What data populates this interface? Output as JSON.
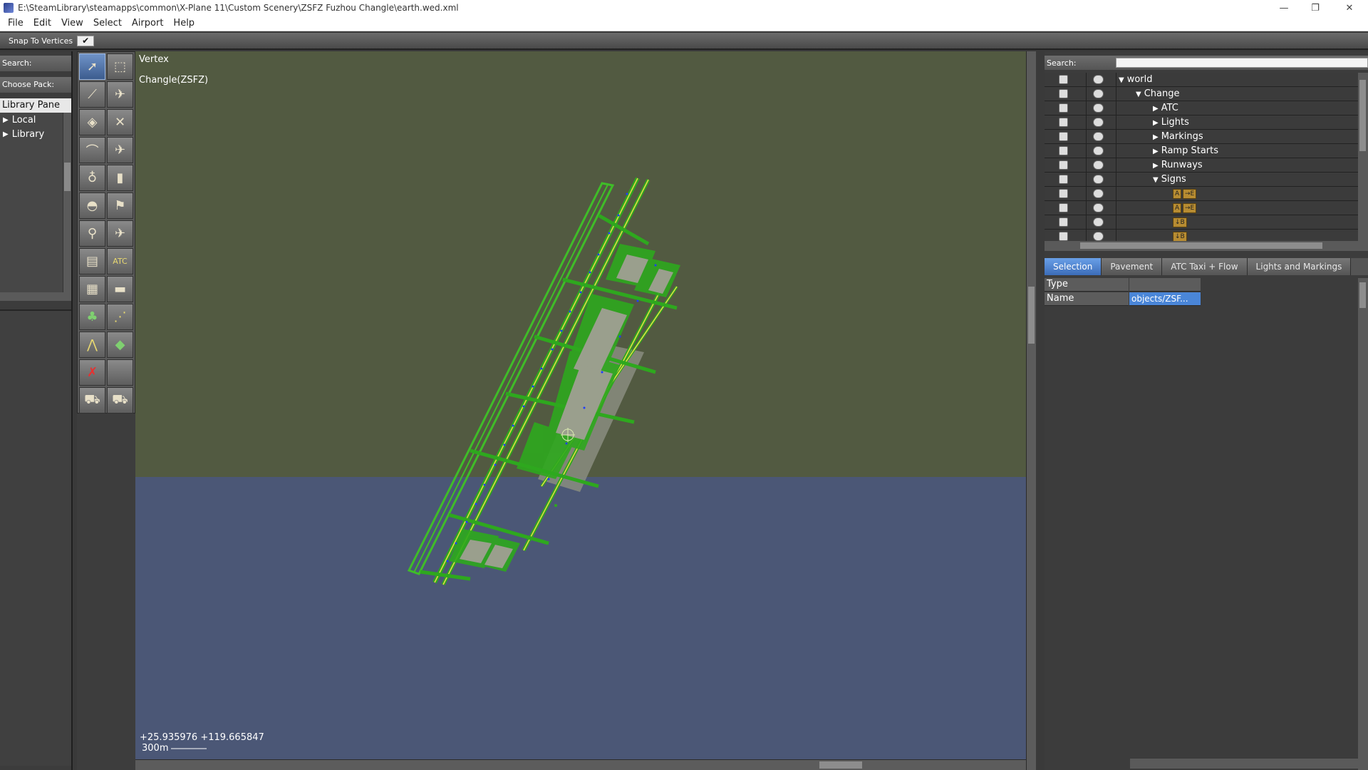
{
  "window": {
    "title": "E:\\SteamLibrary\\steamapps\\common\\X-Plane 11\\Custom Scenery\\ZSFZ Fuzhou Changle\\earth.wed.xml",
    "minimize": "—",
    "restore": "❐",
    "close": "✕"
  },
  "menu": [
    "File",
    "Edit",
    "View",
    "Select",
    "Airport",
    "Help"
  ],
  "toolbar": {
    "snap_label": "Snap To Vertices",
    "snap_check": "✔"
  },
  "library": {
    "search_label": "Search:",
    "pack_label": "Choose Pack:",
    "header": "Library Pane",
    "items": [
      {
        "label": "Local",
        "icon": "triangle-right-icon"
      },
      {
        "label": "Library",
        "icon": "triangle-right-icon"
      }
    ]
  },
  "tools": [
    "vertex-tool-icon",
    "marquee-tool-icon",
    "runway-tool-icon",
    "helipad-tool-icon",
    "sealane-tool-icon",
    "taxiway-tool-icon",
    "boundary-tool-icon",
    "ramp-start-tool-icon",
    "light-fixture-tool-icon",
    "sign-tool-icon",
    "tower-viewpoint-tool-icon",
    "windsock-tool-icon",
    "beacon-tool-icon",
    "airplane-tool-icon",
    "facade-tool-icon",
    "atc-tool-icon",
    "forest-tool-icon",
    "object-tool-icon",
    "tree-tool-icon",
    "string-tool-icon",
    "line-tool-icon",
    "polygon-tool-icon",
    "exclusion-tool-icon",
    "blank-tool-icon",
    "truck-parking-tool-icon",
    "truck-destination-tool-icon"
  ],
  "tool_labels": {
    "atc": "ATC"
  },
  "map": {
    "mode": "Vertex",
    "airport": "Changle(ZSFZ)",
    "coords": "+25.935976 +119.665847",
    "scale": "300m"
  },
  "hierarchy": {
    "search_label": "Search:",
    "rows": [
      {
        "label": "world",
        "depth": 0,
        "expanded": true
      },
      {
        "label": "Change",
        "depth": 1,
        "expanded": true
      },
      {
        "label": "ATC",
        "depth": 2,
        "expanded": false
      },
      {
        "label": "Lights",
        "depth": 2,
        "expanded": false
      },
      {
        "label": "Markings",
        "depth": 2,
        "expanded": false
      },
      {
        "label": "Ramp Starts",
        "depth": 2,
        "expanded": false
      },
      {
        "label": "Runways",
        "depth": 2,
        "expanded": false
      },
      {
        "label": "Signs",
        "depth": 2,
        "expanded": true
      }
    ],
    "signs": [
      [
        "A",
        "→E"
      ],
      [
        "A",
        "→E"
      ],
      [
        "↓B"
      ],
      [
        "↓B"
      ]
    ]
  },
  "tabs": [
    "Selection",
    "Pavement",
    "ATC Taxi + Flow",
    "Lights and Markings"
  ],
  "properties": [
    {
      "key": "Type",
      "value": ""
    },
    {
      "key": "Name",
      "value": "objects/ZSF..."
    }
  ],
  "colors": {
    "ground": "#525a41",
    "water": "#4b5776",
    "taxi": "#2ea81e",
    "accent": "#4a86d8"
  }
}
